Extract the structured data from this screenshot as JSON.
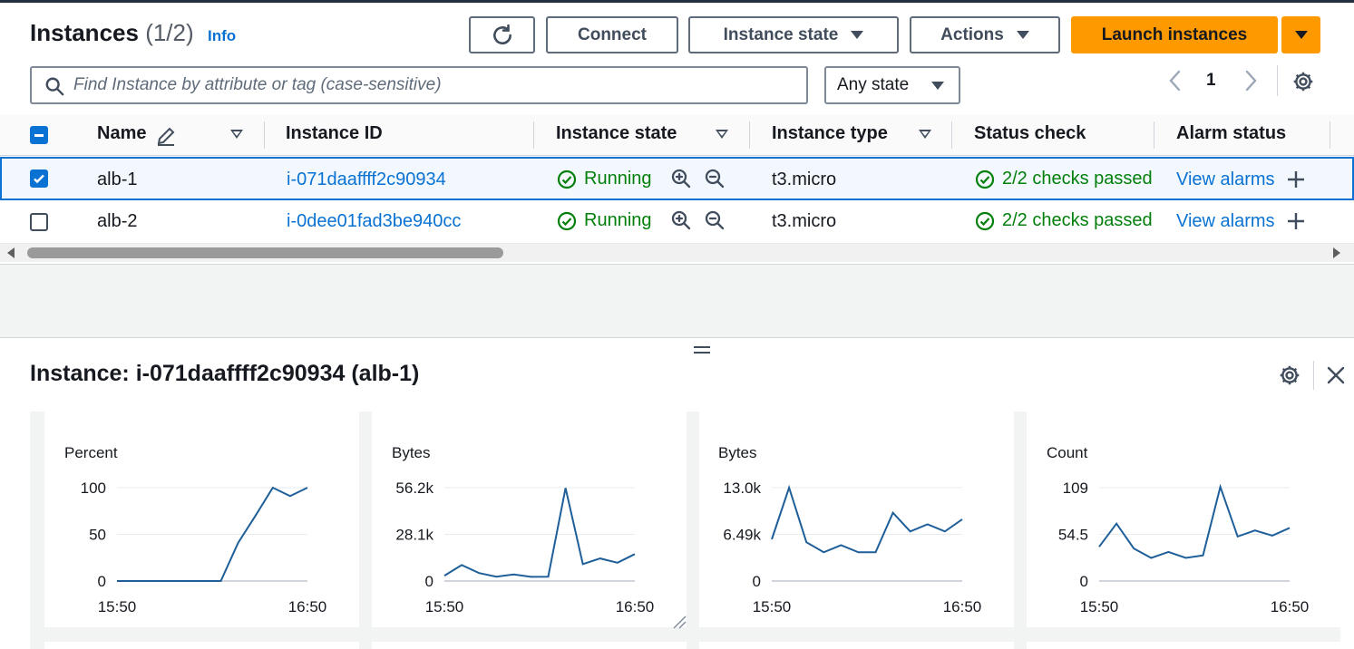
{
  "header": {
    "title": "Instances",
    "count": "(1/2)",
    "info": "Info"
  },
  "toolbar": {
    "refresh_icon": "refresh-icon",
    "connect": "Connect",
    "instance_state": "Instance state",
    "actions": "Actions",
    "launch": "Launch instances"
  },
  "search": {
    "placeholder": "Find Instance by attribute or tag (case-sensitive)",
    "state_filter": "Any state"
  },
  "pagination": {
    "page": "1"
  },
  "table": {
    "columns": [
      "Name",
      "Instance ID",
      "Instance state",
      "Instance type",
      "Status check",
      "Alarm status"
    ],
    "rows": [
      {
        "selected": true,
        "name": "alb-1",
        "id": "i-071daaffff2c90934",
        "state": "Running",
        "type": "t3.micro",
        "status": "2/2 checks passed",
        "alarm": "View alarms"
      },
      {
        "selected": false,
        "name": "alb-2",
        "id": "i-0dee01fad3be940cc",
        "state": "Running",
        "type": "t3.micro",
        "status": "2/2 checks passed",
        "alarm": "View alarms"
      }
    ]
  },
  "colors": {
    "accent": "#0972d3",
    "launch": "#ff9900",
    "success": "#037f0c",
    "chart_line": "#1f5f99"
  },
  "panel": {
    "title": "Instance: i-071daaffff2c90934 (alb-1)"
  },
  "chart_data": [
    {
      "type": "line",
      "ylabel": "Percent",
      "y_ticks": [
        "100",
        "50",
        "0"
      ],
      "ylim": [
        0,
        100
      ],
      "x_ticks": [
        "15:50",
        "16:50"
      ],
      "series": [
        {
          "values": [
            0,
            0,
            0,
            0,
            0,
            0,
            0,
            41,
            70,
            100,
            91,
            100
          ]
        }
      ]
    },
    {
      "type": "line",
      "ylabel": "Bytes",
      "y_ticks": [
        "56.2k",
        "28.1k",
        "0"
      ],
      "ylim": [
        0,
        56.2
      ],
      "x_ticks": [
        "15:50",
        "16:50"
      ],
      "series": [
        {
          "values": [
            3.2,
            9.6,
            4.8,
            2.6,
            4.0,
            2.5,
            2.6,
            56.0,
            10.2,
            13.6,
            11.0,
            16.2
          ]
        }
      ]
    },
    {
      "type": "line",
      "ylabel": "Bytes",
      "y_ticks": [
        "13.0k",
        "6.49k",
        "0"
      ],
      "ylim": [
        0,
        13.0
      ],
      "x_ticks": [
        "15:50",
        "16:50"
      ],
      "series": [
        {
          "values": [
            5.8,
            13.0,
            5.4,
            4.0,
            5.0,
            4.0,
            4.0,
            9.5,
            6.9,
            7.9,
            6.9,
            8.6
          ]
        }
      ]
    },
    {
      "type": "line",
      "ylabel": "Count",
      "y_ticks": [
        "109",
        "54.5",
        "0"
      ],
      "ylim": [
        0,
        109
      ],
      "x_ticks": [
        "15:50",
        "16:50"
      ],
      "series": [
        {
          "values": [
            40,
            67,
            38,
            27,
            34,
            27,
            30,
            110,
            52,
            59,
            53,
            62
          ]
        }
      ]
    }
  ]
}
